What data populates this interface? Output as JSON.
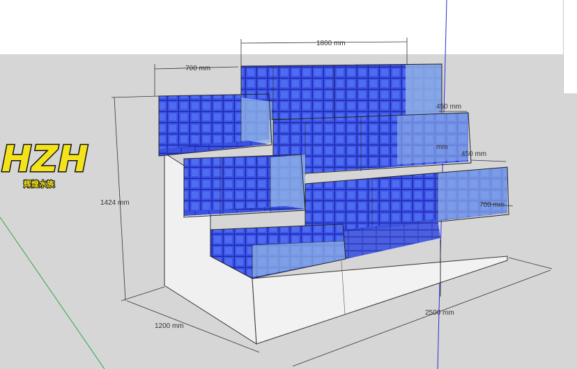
{
  "logo": {
    "text": "HZH",
    "subtitle": "辉煌水族",
    "color": "#f4e21a"
  },
  "dimensions": {
    "top_width": "1800 mm",
    "tank_depth_top": "700 mm",
    "depth_a": "450 mm",
    "depth_b": "450 mm",
    "depth_c": "700 mm",
    "mm_partial": "mm",
    "height": "1424 mm",
    "base_depth": "1200 mm",
    "total_width": "2500 mm"
  },
  "colors": {
    "background": "#d6d6d6",
    "tile_blue": "#2f3fd8",
    "glass": "#8fb1e6",
    "cabinet": "#f2f2f2",
    "axis_blue": "#2b2bd6",
    "axis_green": "#2ea84a"
  }
}
